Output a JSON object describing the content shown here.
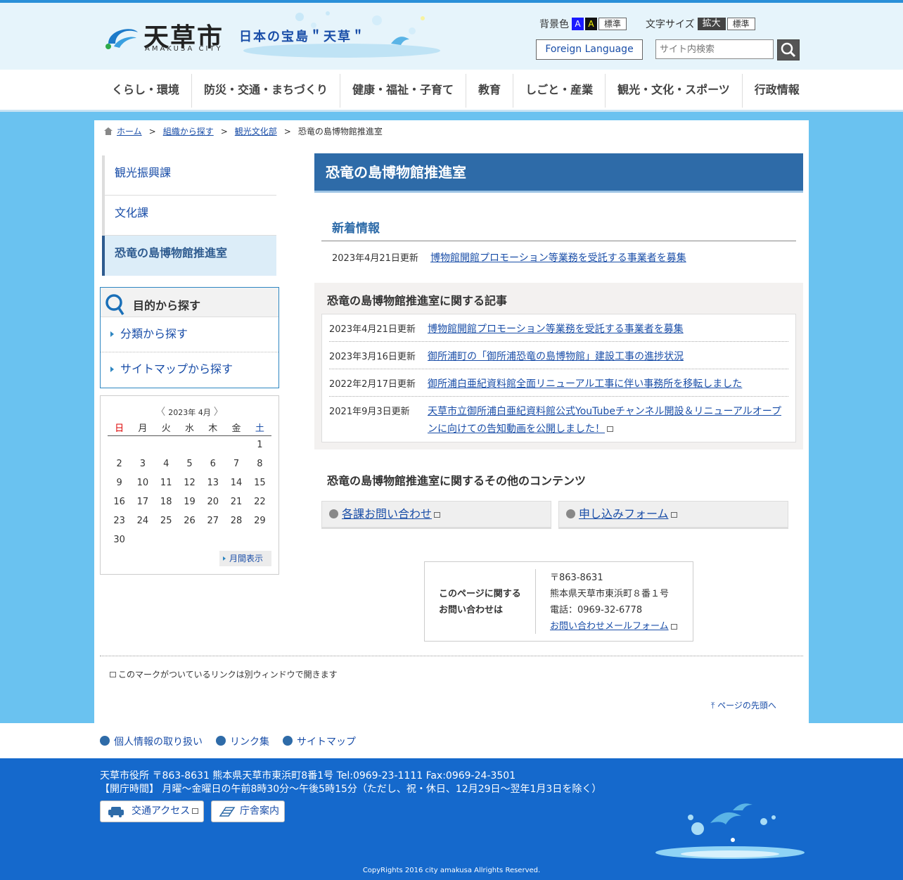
{
  "header": {
    "logo_jp": "天草市",
    "logo_en": "AMAKUSA CITY",
    "tagline": "日本の宝島＂天草＂",
    "bg_color_label": "背景色",
    "bg_blue": "A",
    "bg_black": "A",
    "bg_std": "標準",
    "font_size_label": "文字サイズ",
    "font_big": "拡大",
    "font_std": "標準",
    "foreign_language": "Foreign Language",
    "search_placeholder": "サイト内検索"
  },
  "nav": [
    "くらし・環境",
    "防災・交通・まちづくり",
    "健康・福祉・子育て",
    "教育",
    "しごと・産業",
    "観光・文化・スポーツ",
    "行政情報"
  ],
  "breadcrumb": {
    "home": "ホーム",
    "sep": ">",
    "org": "組織から探す",
    "dept": "観光文化部",
    "current": "恐竜の島博物館推進室"
  },
  "sidebar": {
    "items": [
      {
        "label": "観光振興課"
      },
      {
        "label": "文化課"
      },
      {
        "label": "恐竜の島博物館推進室"
      }
    ],
    "purpose_title": "目的から探す",
    "purpose_links": [
      "分類から探す",
      "サイトマップから探す"
    ]
  },
  "calendar": {
    "header": "2023年 4月",
    "weekdays": [
      "日",
      "月",
      "火",
      "水",
      "木",
      "金",
      "土"
    ],
    "weeks": [
      [
        "",
        "",
        "",
        "",
        "",
        "",
        "1"
      ],
      [
        "2",
        "3",
        "4",
        "5",
        "6",
        "7",
        "8"
      ],
      [
        "9",
        "10",
        "11",
        "12",
        "13",
        "14",
        "15"
      ],
      [
        "16",
        "17",
        "18",
        "19",
        "20",
        "21",
        "22"
      ],
      [
        "23",
        "24",
        "25",
        "26",
        "27",
        "28",
        "29"
      ],
      [
        "30",
        "",
        "",
        "",
        "",
        "",
        ""
      ]
    ],
    "month_view": "月間表示"
  },
  "main": {
    "title": "恐竜の島博物館推進室",
    "news_heading": "新着情報",
    "news": {
      "date": "2023年4月21日更新",
      "title": "博物館開館プロモーション等業務を受託する事業者を募集"
    },
    "related_heading": "恐竜の島博物館推進室に関する記事",
    "articles": [
      {
        "date": "2023年4月21日更新",
        "title": "博物館開館プロモーション等業務を受託する事業者を募集"
      },
      {
        "date": "2023年3月16日更新",
        "title": "御所浦町の「御所浦恐竜の島博物館」建設工事の進捗状況"
      },
      {
        "date": "2022年2月17日更新",
        "title": "御所浦白亜紀資料館全面リニューアル工事に伴い事務所を移転しました"
      },
      {
        "date": "2021年9月3日更新",
        "title": "天草市立御所浦白亜紀資料館公式YouTubeチャンネル開設＆リニューアルオープンに向けての告知動画を公開しました！"
      }
    ],
    "other_heading": "恐竜の島博物館推進室に関するその他のコンテンツ",
    "other_links": [
      "各課お問い合わせ",
      "申し込みフォーム"
    ],
    "contact": {
      "label_1": "このページに関する",
      "label_2": "お問い合わせは",
      "postal": "〒863-8631",
      "address": "熊本県天草市東浜町８番１号",
      "phone": "電話：0969-32-6778",
      "form": "お問い合わせメールフォーム"
    },
    "ext_note": "このマークがついているリンクは別ウィンドウで開きます",
    "to_top": "ページの先頭へ"
  },
  "footer": {
    "links": [
      "個人情報の取り扱い",
      "リンク集",
      "サイトマップ"
    ],
    "address": "天草市役所 〒863-8631  熊本県天草市東浜町8番1号   Tel:0969-23-1111   Fax:0969-24-3501",
    "hours": "【開庁時間】 月曜～金曜日の午前8時30分～午後5時15分（ただし、祝・休日、12月29日～翌年1月3日を除く）",
    "access": "交通アクセス",
    "guide": "庁舎案内",
    "copyright": "CopyRights 2016 city amakusa Allrights Reserved."
  }
}
